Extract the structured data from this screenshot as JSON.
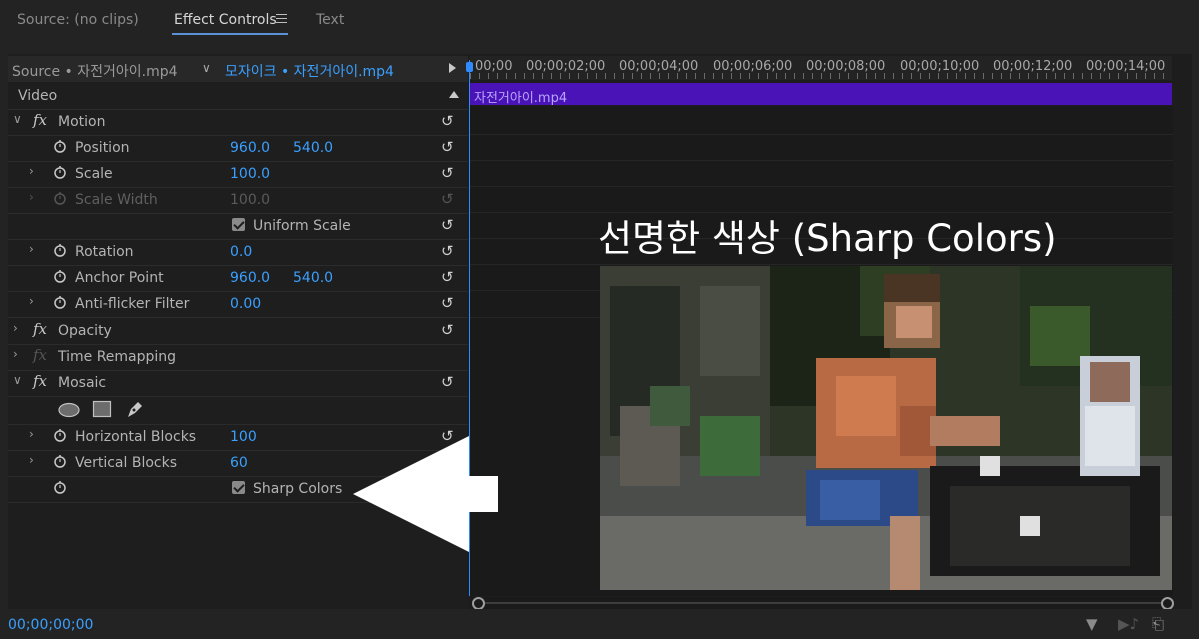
{
  "tabs": [
    {
      "label": "Source: (no clips)",
      "active": false
    },
    {
      "label": "Effect Controls",
      "active": true
    },
    {
      "label": "Text",
      "active": false
    }
  ],
  "header": {
    "source_label": "Source • 자전거아이.mp4",
    "sequence_label": "모자이크 • 자전거아이.mp4"
  },
  "video_section": "Video",
  "effects": {
    "motion": {
      "label": "Motion",
      "position": {
        "label": "Position",
        "x": "960.0",
        "y": "540.0"
      },
      "scale": {
        "label": "Scale",
        "value": "100.0"
      },
      "scale_width": {
        "label": "Scale Width",
        "value": "100.0"
      },
      "uniform_scale": {
        "label": "Uniform Scale",
        "checked": true
      },
      "rotation": {
        "label": "Rotation",
        "value": "0.0"
      },
      "anchor_point": {
        "label": "Anchor Point",
        "x": "960.0",
        "y": "540.0"
      },
      "anti_flicker": {
        "label": "Anti-flicker Filter",
        "value": "0.00"
      }
    },
    "opacity": {
      "label": "Opacity"
    },
    "time_remapping": {
      "label": "Time Remapping"
    },
    "mosaic": {
      "label": "Mosaic",
      "horizontal_blocks": {
        "label": "Horizontal Blocks",
        "value": "100"
      },
      "vertical_blocks": {
        "label": "Vertical Blocks",
        "value": "60"
      },
      "sharp_colors": {
        "label": "Sharp Colors",
        "checked": true
      }
    }
  },
  "timeline": {
    "ticks": [
      "00;00",
      "00;00;02;00",
      "00;00;04;00",
      "00;00;06;00",
      "00;00;08;00",
      "00;00;10;00",
      "00;00;12;00",
      "00;00;14;00"
    ],
    "clip_name": "자전거아이.mp4"
  },
  "overlay_title": "선명한 색상 (Sharp Colors)",
  "timecode": "00;00;00;00",
  "colors": {
    "accent": "#3aa0ff",
    "clip": "#4a13b8",
    "panel": "#1e1e1e"
  }
}
